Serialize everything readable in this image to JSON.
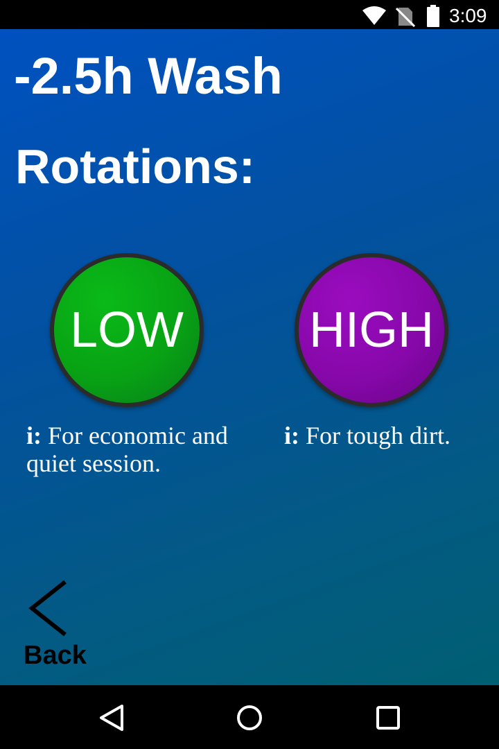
{
  "status_bar": {
    "time": "3:09",
    "icons": [
      "wifi-icon",
      "no-sim-icon",
      "battery-icon"
    ]
  },
  "screen": {
    "title": "-2.5h Wash",
    "subtitle": "Rotations:"
  },
  "options": {
    "low": {
      "label": "LOW",
      "color": "#08a214",
      "info_prefix": "i:",
      "info_text": "For economic and quiet session."
    },
    "high": {
      "label": "HIGH",
      "color": "#8708aa",
      "info_prefix": "i:",
      "info_text": "For tough dirt."
    }
  },
  "back_button": {
    "label": "Back",
    "icon": "chevron-left-icon"
  },
  "nav_bar": {
    "icons": [
      "nav-back-icon",
      "nav-home-icon",
      "nav-recents-icon"
    ]
  },
  "colors": {
    "background_top": "#0051c0",
    "background_bottom": "#005f72",
    "text": "#ffffff"
  }
}
